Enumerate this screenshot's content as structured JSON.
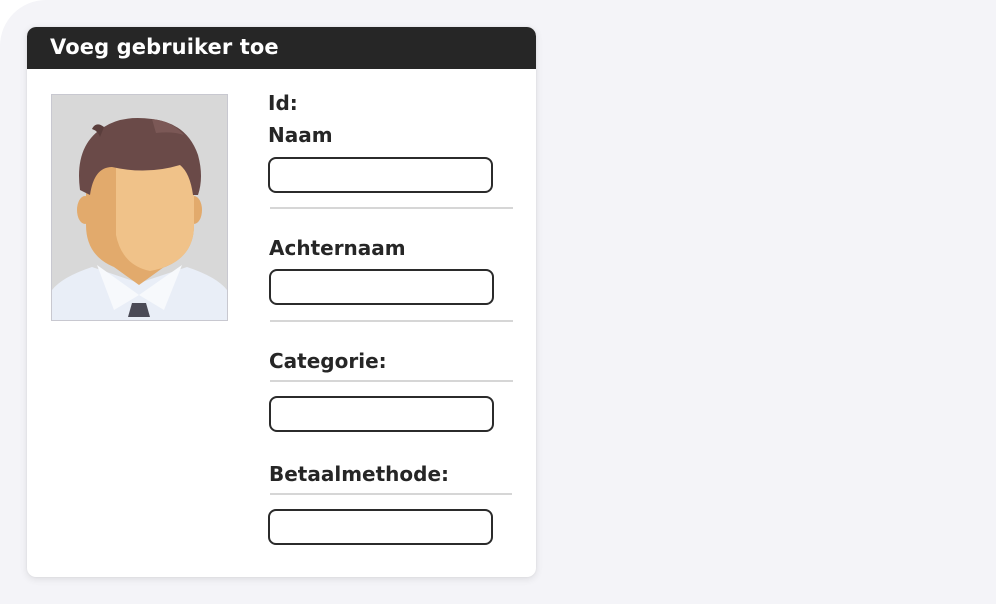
{
  "dialog": {
    "title": "Voeg gebruiker toe"
  },
  "avatar": {
    "icon": "user-avatar-placeholder",
    "colors": {
      "background": "#d8d8d8",
      "hair": "#6a4a48",
      "skin": "#f0c289",
      "skin_shadow": "#e2aa6c",
      "shirt": "#e9eef7",
      "tie": "#4a4a56"
    }
  },
  "form": {
    "id_label": "Id:",
    "first_name": {
      "label": "Naam",
      "value": ""
    },
    "last_name": {
      "label": "Achternaam",
      "value": ""
    },
    "category": {
      "label": "Categorie:",
      "value": ""
    },
    "payment_method": {
      "label": "Betaalmethode:",
      "value": ""
    }
  },
  "colors": {
    "header_bg": "#262626",
    "page_bg": "#f4f4f8",
    "card_bg": "#ffffff"
  }
}
